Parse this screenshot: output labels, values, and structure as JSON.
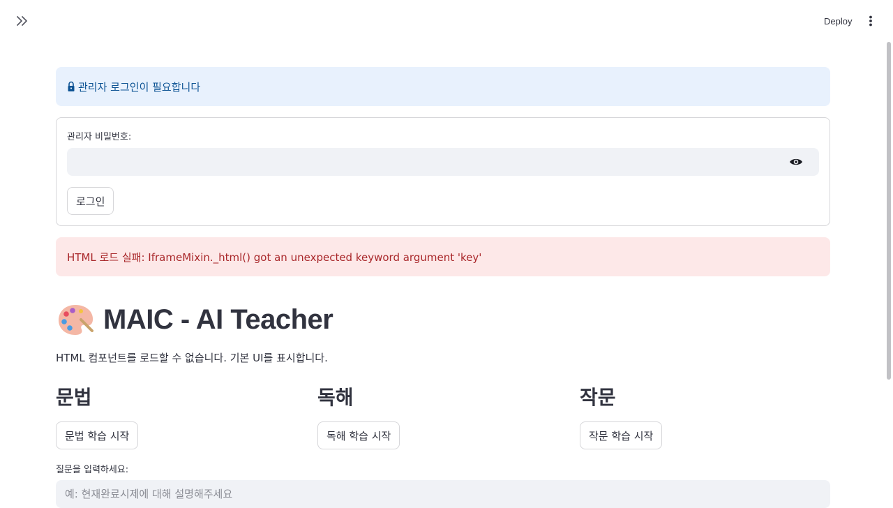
{
  "toolbar": {
    "deploy_label": "Deploy",
    "expand_icon": "double-chevron-right-icon",
    "menu_icon": "vertical-dots-icon"
  },
  "info": {
    "icon": "lock-icon",
    "message": "관리자 로그인이 필요합니다",
    "color": "#0d5394",
    "background": "#e8f1fd"
  },
  "login_form": {
    "password_label": "관리자 비밀번호:",
    "password_value": "",
    "toggle_icon": "eye-icon",
    "login_label": "로그인"
  },
  "error": {
    "message": "HTML 로드 실패: IframeMixin._html() got an unexpected keyword argument 'key'",
    "color": "#a9272a",
    "background": "#fde8e8"
  },
  "header": {
    "icon": "palette-icon",
    "title": "MAIC - AI Teacher",
    "subtitle": "HTML 컴포넌트를 로드할 수 없습니다. 기본 UI를 표시합니다."
  },
  "sections": [
    {
      "heading": "문법",
      "button_label": "문법 학습 시작"
    },
    {
      "heading": "독해",
      "button_label": "독해 학습 시작"
    },
    {
      "heading": "작문",
      "button_label": "작문 학습 시작"
    }
  ],
  "question": {
    "label": "질문을 입력하세요:",
    "placeholder": "예: 현재완료시제에 대해 설명해주세요",
    "value": ""
  }
}
